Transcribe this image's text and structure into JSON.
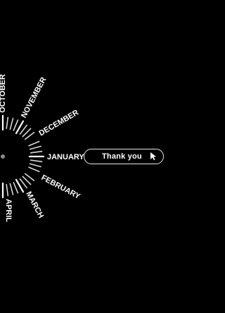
{
  "months": [
    "JANUARY",
    "DECEMBER",
    "NOVEMBER",
    "OCTOBER",
    "FEBRUARY",
    "MARCH",
    "APRIL"
  ],
  "selected_month": "JANUARY",
  "action_button": {
    "label": "Thank you",
    "icon": "cursor-arrow-icon"
  },
  "colors": {
    "background": "#000000",
    "text": "#ffffff",
    "ticks": "#d8d8d8"
  }
}
